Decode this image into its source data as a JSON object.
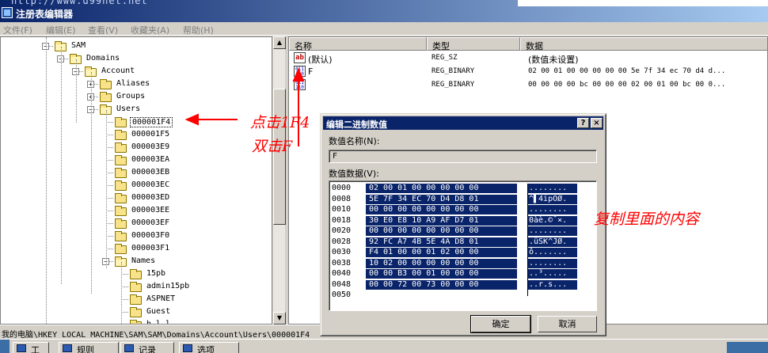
{
  "window": {
    "url_ghost": "http://www.d99net.net",
    "title": "注册表编辑器"
  },
  "menu": [
    "文件(F)",
    "编辑(E)",
    "查看(V)",
    "收藏夹(A)",
    "帮助(H)"
  ],
  "tree": [
    {
      "label": "SAM",
      "depth": 0,
      "expander": "−",
      "open": true
    },
    {
      "label": "Domains",
      "depth": 1,
      "expander": "−",
      "open": true
    },
    {
      "label": "Account",
      "depth": 2,
      "expander": "−",
      "open": true
    },
    {
      "label": "Aliases",
      "depth": 3,
      "expander": "+",
      "open": false
    },
    {
      "label": "Groups",
      "depth": 3,
      "expander": "+",
      "open": false
    },
    {
      "label": "Users",
      "depth": 3,
      "expander": "−",
      "open": true
    },
    {
      "label": "000001F4",
      "depth": 4,
      "expander": "",
      "open": false,
      "selected": true
    },
    {
      "label": "000001F5",
      "depth": 4,
      "expander": "",
      "open": false
    },
    {
      "label": "000003E9",
      "depth": 4,
      "expander": "",
      "open": false
    },
    {
      "label": "000003EA",
      "depth": 4,
      "expander": "",
      "open": false
    },
    {
      "label": "000003EB",
      "depth": 4,
      "expander": "",
      "open": false
    },
    {
      "label": "000003EC",
      "depth": 4,
      "expander": "",
      "open": false
    },
    {
      "label": "000003ED",
      "depth": 4,
      "expander": "",
      "open": false
    },
    {
      "label": "000003EE",
      "depth": 4,
      "expander": "",
      "open": false
    },
    {
      "label": "000003EF",
      "depth": 4,
      "expander": "",
      "open": false
    },
    {
      "label": "000003F0",
      "depth": 4,
      "expander": "",
      "open": false
    },
    {
      "label": "000003F1",
      "depth": 4,
      "expander": "",
      "open": false
    },
    {
      "label": "Names",
      "depth": 4,
      "expander": "−",
      "open": true
    },
    {
      "label": "15pb",
      "depth": 5,
      "expander": "",
      "open": false
    },
    {
      "label": "admin15pb",
      "depth": 5,
      "expander": "",
      "open": false
    },
    {
      "label": "ASPNET",
      "depth": 5,
      "expander": "",
      "open": false
    },
    {
      "label": "Guest",
      "depth": 5,
      "expander": "",
      "open": false
    },
    {
      "label": "h.l.l.",
      "depth": 5,
      "expander": "",
      "open": false
    }
  ],
  "values": {
    "columns": [
      "名称",
      "类型",
      "数据"
    ],
    "rows": [
      {
        "icon": "ab",
        "name": "(默认)",
        "type": "REG_SZ",
        "data": "(数值未设置)"
      },
      {
        "icon": "bin",
        "name": "F",
        "type": "REG_BINARY",
        "data": "02 00 01 00 00 00 00 00 5e 7f 34 ec 70 d4 d..."
      },
      {
        "icon": "bin",
        "name": "V",
        "type": "REG_BINARY",
        "data": "00 00 00 00 bc 00 00 00 02 00 01 00 bc 00 0..."
      }
    ]
  },
  "statusbar": "我的电脑\\HKEY_LOCAL_MACHINE\\SAM\\SAM\\Domains\\Account\\Users\\000001F4",
  "taskbar": [
    "工具",
    "规则",
    "记录",
    "选项"
  ],
  "dialog": {
    "title": "编辑二进制数值",
    "help_btn": "?",
    "close_btn": "×",
    "name_label": "数值名称(N):",
    "name_value": "F",
    "data_label": "数值数据(V):",
    "ok": "确定",
    "cancel": "取消",
    "hex": [
      {
        "off": "0000",
        "hex": "02 00 01 00 00 00 00 00",
        "asc": "........"
      },
      {
        "off": "0008",
        "hex": "5E 7F 34 EC 70 D4 D8 01",
        "asc": "^▌4ipÔØ."
      },
      {
        "off": "0010",
        "hex": "00 00 00 00 00 00 00 00",
        "asc": "........"
      },
      {
        "off": "0018",
        "hex": "30 E0 E8 10 A9 AF D7 01",
        "asc": "0àè.©¯×."
      },
      {
        "off": "0020",
        "hex": "00 00 00 00 00 00 00 00",
        "asc": "........"
      },
      {
        "off": "0028",
        "hex": "92 FC A7 4B 5E 4A D8 01",
        "asc": ".üSK^JØ."
      },
      {
        "off": "0030",
        "hex": "F4 01 00 00 01 02 00 00",
        "asc": "ô......."
      },
      {
        "off": "0038",
        "hex": "10 02 00 00 00 00 00 00",
        "asc": "........"
      },
      {
        "off": "0040",
        "hex": "00 00 B3 00 01 00 00 00",
        "asc": "..³....."
      },
      {
        "off": "0048",
        "hex": "00 00 72 00 73 00 00 00",
        "asc": "..r.s..."
      },
      {
        "off": "0050",
        "hex": "",
        "asc": ""
      }
    ]
  },
  "annotations": {
    "click": "点击1F4",
    "dblclick": "双击F",
    "copy": "复制里面的内容"
  },
  "colors": {
    "annotation": "#ff0000",
    "selection": "#0a246a",
    "titlebar": "#0a246a"
  }
}
